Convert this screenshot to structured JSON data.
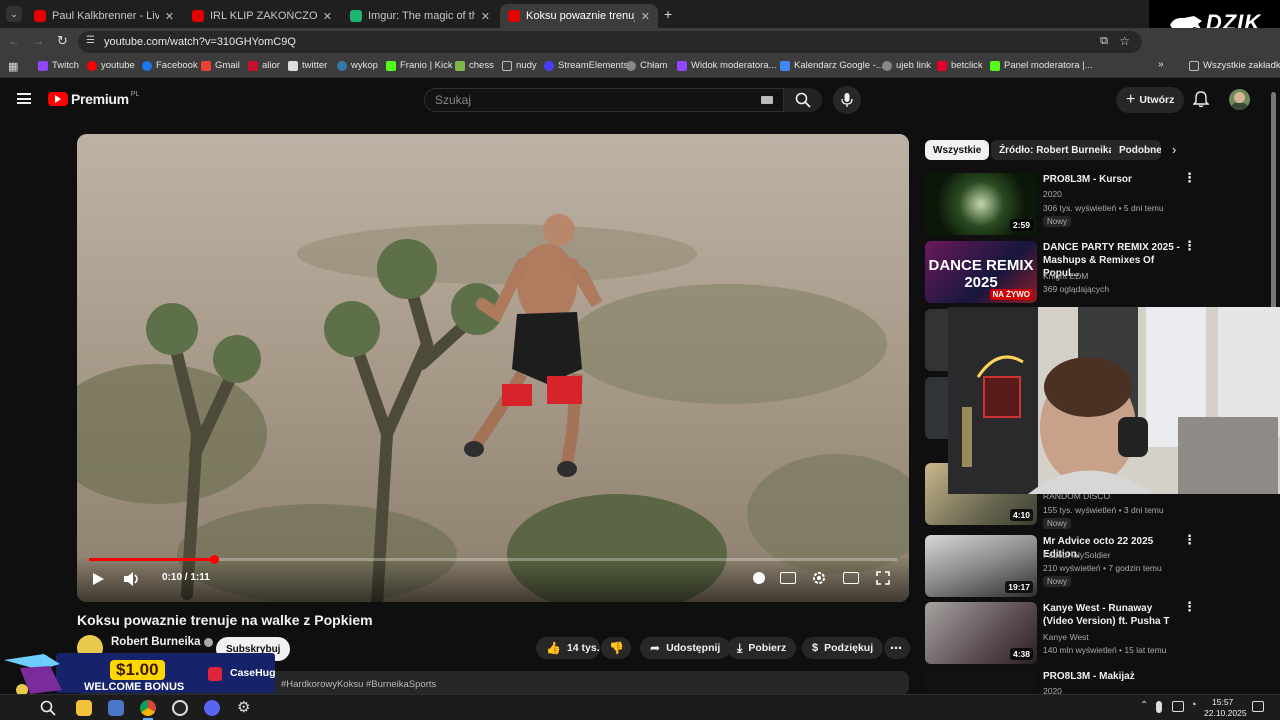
{
  "browser": {
    "tabs": [
      {
        "title": "Paul Kalkbrenner - Live at Tomo",
        "favicon_color": "#e60000"
      },
      {
        "title": "IRL KLIP ZAKOŃCZONY I JEDZI",
        "favicon_color": "#e60000"
      },
      {
        "title": "Imgur: The magic of the Interne",
        "favicon_color": "#1bb76e"
      },
      {
        "title": "Koksu powaznie trenuje na walk",
        "favicon_color": "#e60000"
      }
    ],
    "url": "youtube.com/watch?v=310GHYomC9Q",
    "bookmarks": [
      {
        "label": "Twitch",
        "color": "#9146ff"
      },
      {
        "label": "youtube",
        "color": "#ff0000"
      },
      {
        "label": "Facebook",
        "color": "#1877f2"
      },
      {
        "label": "Gmail",
        "color": "#ea4335"
      },
      {
        "label": "alior",
        "color": "#c8102e"
      },
      {
        "label": "twitter",
        "color": "#dddddd"
      },
      {
        "label": "wykop",
        "color": "#367aa9"
      },
      {
        "label": "Franio | Kick",
        "color": "#53fc18"
      },
      {
        "label": "chess",
        "color": "#81b64c"
      },
      {
        "label": "nudy",
        "color": "#bbbbbb"
      },
      {
        "label": "StreamElements",
        "color": "#4b3fff"
      },
      {
        "label": "Chłam",
        "color": "#bbbbbb"
      },
      {
        "label": "Widok moderatora...",
        "color": "#9146ff"
      },
      {
        "label": "Kalendarz Google -...",
        "color": "#4285f4"
      },
      {
        "label": "ujeb link",
        "color": "#bbbbbb"
      },
      {
        "label": "betclick",
        "color": "#e6002b"
      },
      {
        "label": "Panel moderatora |...",
        "color": "#53fc18"
      }
    ],
    "all_bookmarks": "Wszystkie zakładki"
  },
  "overlay_logo": "DZIK",
  "youtube": {
    "logo": "Premium",
    "logo_region": "PL",
    "search_placeholder": "Szukaj",
    "create_label": "Utwórz",
    "player": {
      "time": "0:10 / 1:11",
      "progress_fraction": 0.155
    },
    "video_title": "Koksu powaznie trenuje na walke z Popkiem",
    "channel": "Robert Burneika",
    "subscribe": "Subskrybuj",
    "likes": "14 tys.",
    "share": "Udostępnij",
    "download": "Pobierz",
    "thanks": "Podziękuj",
    "hashtags": "#HardkorowyKoksu #BurneikaSports",
    "chips": [
      "Wszystkie",
      "Źródło: Robert Burneika",
      "Podobne"
    ],
    "recommendations": [
      {
        "title": "PRO8L3M - Kursor",
        "channel": "2020",
        "meta": "306 tys. wyświetleń • 5 dni temu",
        "duration": "2:59",
        "badge": "Nowy"
      },
      {
        "title": "DANCE PARTY REMIX 2025 - Mashups & Remixes Of Popul...",
        "channel": "Knight EDM",
        "meta": "369 oglądających",
        "duration": "",
        "badge": "NA ŻYWO"
      },
      {
        "title": "",
        "channel": "RANDOM DISCO",
        "meta": "155 tys. wyświetleń • 3 dni temu",
        "duration": "4:10",
        "badge": "Nowy"
      },
      {
        "title": "Mr Advice octo 22 2025 Edition.",
        "channel": "FadedHolySoldier",
        "meta": "210 wyświetleń • 7 godzin temu",
        "duration": "19:17",
        "badge": "Nowy"
      },
      {
        "title": "Kanye West - Runaway (Video Version) ft. Pusha T",
        "channel": "Kanye West",
        "meta": "140 mln wyświetleń • 15 lat temu",
        "duration": "4:38",
        "badge": ""
      },
      {
        "title": "PRO8L3M - Makijaż",
        "channel": "2020",
        "meta": "",
        "duration": "",
        "badge": ""
      }
    ],
    "dance_thumb_text": "DANCE REMIX 2025"
  },
  "ad": {
    "amount": "$1.00",
    "text": "WELCOME BONUS",
    "brand": "CaseHug"
  },
  "taskbar": {
    "time": "15:57",
    "date": "22.10.2025"
  }
}
